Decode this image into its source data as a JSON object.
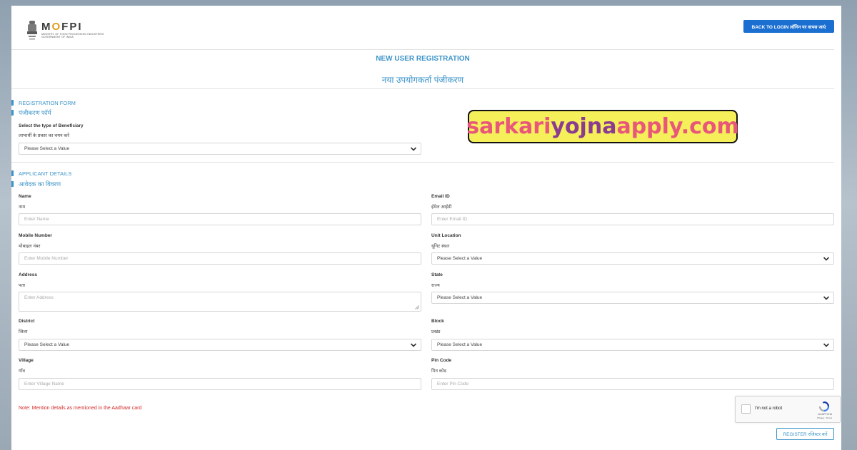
{
  "header": {
    "logo_word": "MOFPI",
    "logo_line1": "MINISTRY OF FOOD PROCESSING INDUSTRIES",
    "logo_line2": "GOVERNMENT OF INDIA",
    "back_button": "BACK TO LOGIN लॉगिन पर वापस जाएं"
  },
  "title": {
    "en": "NEW USER REGISTRATION",
    "hi": "नया उपयोगकर्ता पंजीकरण"
  },
  "registration_form": {
    "heading_en": "REGISTRATION FORM",
    "heading_hi": "पंजीकरण फॉर्म",
    "beneficiary": {
      "label_en": "Select the type of Beneficiary",
      "label_hi": "लाभार्थी के प्रकार का चयन करें",
      "value": "Please Select a Value"
    }
  },
  "watermark": {
    "part1": "sarkari",
    "part2": "yojna",
    "part3": "apply.com"
  },
  "applicant": {
    "heading_en": "APPLICANT DETAILS",
    "heading_hi": "आवेदक का विवरण",
    "name": {
      "label_en": "Name",
      "label_hi": "नाम",
      "placeholder": "Enter Name"
    },
    "email": {
      "label_en": "Email ID",
      "label_hi": "ईमेल आईडी",
      "placeholder": "Enter Email ID"
    },
    "mobile": {
      "label_en": "Mobile Number",
      "label_hi": "मोबाइल नंबर",
      "placeholder": "Enter Mobile Number"
    },
    "unit_location": {
      "label_en": "Unit Location",
      "label_hi": "यूनिट स्थल",
      "value": "Please Select a Value"
    },
    "address": {
      "label_en": "Address",
      "label_hi": "पता",
      "placeholder": "Enter Address"
    },
    "state": {
      "label_en": "State",
      "label_hi": "राज्य",
      "value": "Please Select a Value"
    },
    "district": {
      "label_en": "District",
      "label_hi": "जिला",
      "value": "Please Select a Value"
    },
    "block": {
      "label_en": "Block",
      "label_hi": "प्रखंड",
      "value": "Please Select a Value"
    },
    "village": {
      "label_en": "Village",
      "label_hi": "गाँव",
      "placeholder": "Enter Village Name"
    },
    "pincode": {
      "label_en": "Pin Code",
      "label_hi": "पिन कोड",
      "placeholder": "Enter Pin Code"
    }
  },
  "note": "Note: Mention details as mentioned in the Aadhaar card",
  "captcha": {
    "label": "I'm not a robot",
    "brand": "reCAPTCHA",
    "terms": "Privacy - Terms"
  },
  "register_button": "REGISTER रजिस्टर करें"
}
